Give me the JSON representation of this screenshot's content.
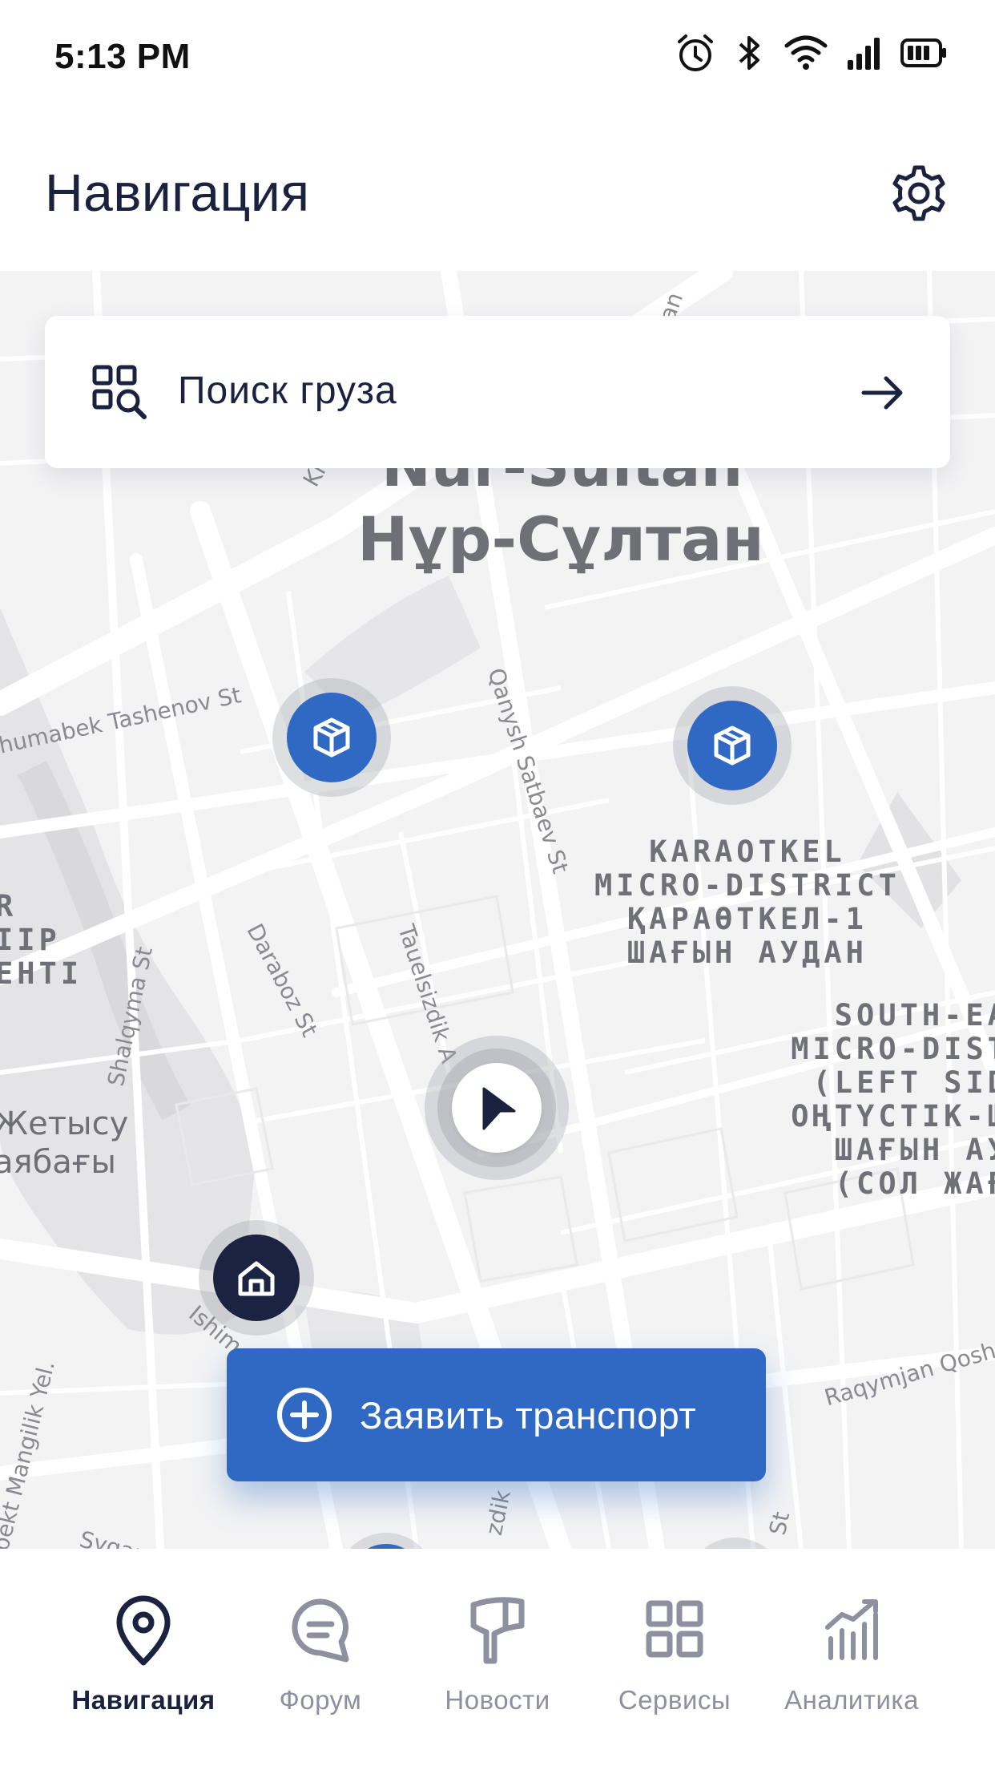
{
  "status_bar": {
    "time": "5:13 PM",
    "icons": [
      "alarm-icon",
      "bluetooth-icon",
      "wifi-icon",
      "signal-icon",
      "battery-icon"
    ]
  },
  "header": {
    "title": "Навигация",
    "settings_icon": "gear-icon"
  },
  "search": {
    "label": "Поиск груза",
    "icon": "grid-search-icon",
    "arrow_icon": "arrow-right-icon"
  },
  "map": {
    "city_name_latin": "Nur-Sultan",
    "city_name_local": "Нұр-Сұлтан",
    "streets": [
      "Zhumabek Tashenov St",
      "Qanysh Satbaev St",
      "Daraboz St",
      "Tauelsizdik A",
      "Shalqyma St",
      "Ishim",
      "Raqymjan Qosh",
      "pekt Mangilik Yel.",
      "Syganak St",
      "zdik",
      "St",
      "xan",
      "Kl"
    ],
    "districts": {
      "karaotkel": [
        "KARAOTKEL",
        "MICRO-DISTRICT",
        "ҚАРАӨТКЕЛ-1",
        "ШАҒЫН АУДАН"
      ],
      "south_east": [
        "SOUTH-EA",
        "MICRO-DIST",
        "(LEFT SID",
        "ОҢТҮСТІК-Ш",
        "ШАҒЫН АУ",
        "(СОЛ ЖАҒ"
      ],
      "left_partial": [
        "R",
        "IIP",
        "ЕНТІ"
      ],
      "zhetysu": [
        "Жетысу",
        "аябағы"
      ]
    },
    "markers": [
      {
        "type": "cargo",
        "icon": "package-icon"
      },
      {
        "type": "cargo",
        "icon": "package-icon"
      },
      {
        "type": "current-location",
        "icon": "navigation-arrow-icon"
      },
      {
        "type": "home",
        "icon": "home-icon"
      }
    ]
  },
  "cta": {
    "label": "Заявить транспорт",
    "icon": "plus-circle-icon"
  },
  "bottom_nav": {
    "items": [
      {
        "label": "Навигация",
        "icon": "map-pin-icon",
        "active": true
      },
      {
        "label": "Форум",
        "icon": "chat-bubble-icon",
        "active": false
      },
      {
        "label": "Новости",
        "icon": "megaphone-icon",
        "active": false
      },
      {
        "label": "Сервисы",
        "icon": "grid-icon",
        "active": false
      },
      {
        "label": "Аналитика",
        "icon": "analytics-icon",
        "active": false
      }
    ]
  },
  "colors": {
    "primary": "#2f69c4",
    "dark": "#1b2240",
    "inactive": "#8e90a0",
    "map_bg": "#f3f3f4"
  }
}
